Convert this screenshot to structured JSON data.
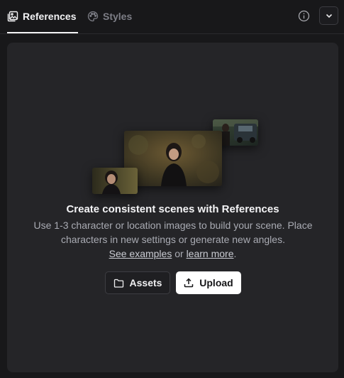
{
  "tabs": {
    "references_label": "References",
    "styles_label": "Styles"
  },
  "header_icons": {
    "info": "info-icon",
    "dropdown": "chevron-down-icon"
  },
  "empty_state": {
    "title": "Create consistent scenes with References",
    "description": "Use 1-3 character or location images to build your scene. Place characters in new settings or generate new angles.",
    "see_examples": "See examples",
    "or_text": " or ",
    "learn_more": "learn more",
    "period": "."
  },
  "buttons": {
    "assets_label": "Assets",
    "upload_label": "Upload"
  },
  "colors": {
    "background": "#18181a",
    "panel": "#252528",
    "active_tab": "#f2f2f4",
    "inactive_tab": "#7d7e86",
    "upload_button": "#ffffff"
  }
}
